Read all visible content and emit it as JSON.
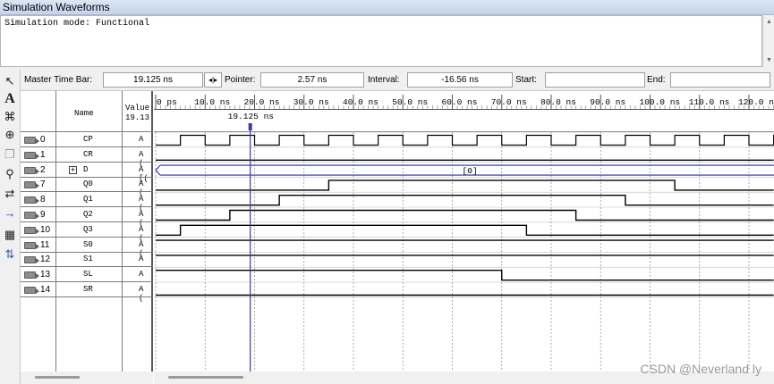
{
  "window": {
    "title": "Simulation Waveforms"
  },
  "sim_mode": {
    "text": "Simulation mode: Functional"
  },
  "info_bar": {
    "master_label": "Master Time Bar:",
    "master_value": "19.125 ns",
    "pointer_label": "Pointer:",
    "pointer_value": "2.57 ns",
    "interval_label": "Interval:",
    "interval_value": "-16.56 ns",
    "start_label": "Start:",
    "start_value": "",
    "end_label": "End:",
    "end_value": ""
  },
  "columns": {
    "name": "Name",
    "value_line1": "Value",
    "value_line2": "19.13"
  },
  "timescale": {
    "ticks": [
      "0 ps",
      "10.0 ns",
      "20.0 ns",
      "30.0 ns",
      "40.0 ns",
      "50.0 ns",
      "60.0 ns",
      "70.0 ns",
      "80.0 ns",
      "90.0 ns",
      "100.0 ns",
      "110.0 ns",
      "120.0 ns"
    ],
    "master_marker_label": "19.125 ns",
    "master_marker_time_ns": 19.125
  },
  "signals": [
    {
      "index": "0",
      "name": "CP",
      "value": "A",
      "kind": "clock",
      "expandable": false
    },
    {
      "index": "1",
      "name": "CR",
      "value": "A (",
      "kind": "bit",
      "expandable": false
    },
    {
      "index": "2",
      "name": "D",
      "value": "A [(",
      "kind": "bus",
      "expandable": true,
      "bus_label": "[0]"
    },
    {
      "index": "7",
      "name": "Q0",
      "value": "A (",
      "kind": "bit",
      "expandable": false
    },
    {
      "index": "8",
      "name": "Q1",
      "value": "A (",
      "kind": "bit",
      "expandable": false
    },
    {
      "index": "9",
      "name": "Q2",
      "value": "A (",
      "kind": "bit",
      "expandable": false
    },
    {
      "index": "10",
      "name": "Q3",
      "value": "A (",
      "kind": "bit",
      "expandable": false
    },
    {
      "index": "11",
      "name": "S0",
      "value": "A (",
      "kind": "bit",
      "expandable": false
    },
    {
      "index": "12",
      "name": "S1",
      "value": "A",
      "kind": "bit",
      "expandable": false
    },
    {
      "index": "13",
      "name": "SL",
      "value": "A",
      "kind": "bit",
      "expandable": false
    },
    {
      "index": "14",
      "name": "SR",
      "value": "A (",
      "kind": "bit",
      "expandable": false
    }
  ],
  "waveforms": {
    "CP": {
      "clock_period_ns": 10,
      "first_rise_ns": 5
    },
    "CR": {
      "segments": [
        [
          0,
          125,
          0
        ]
      ]
    },
    "Q0": {
      "segments": [
        [
          0,
          35,
          0
        ],
        [
          35,
          105,
          1
        ],
        [
          105,
          125,
          0
        ]
      ]
    },
    "Q1": {
      "segments": [
        [
          0,
          25,
          0
        ],
        [
          25,
          95,
          1
        ],
        [
          95,
          125,
          0
        ]
      ]
    },
    "Q2": {
      "segments": [
        [
          0,
          15,
          0
        ],
        [
          15,
          85,
          1
        ],
        [
          85,
          125,
          0
        ]
      ]
    },
    "Q3": {
      "segments": [
        [
          0,
          5,
          0
        ],
        [
          5,
          75,
          1
        ],
        [
          75,
          125,
          0
        ]
      ]
    },
    "S0": {
      "segments": [
        [
          0,
          125,
          1
        ]
      ]
    },
    "S1": {
      "segments": [
        [
          0,
          125,
          1
        ]
      ]
    },
    "SL": {
      "segments": [
        [
          0,
          70,
          1
        ],
        [
          70,
          125,
          0
        ]
      ]
    },
    "SR": {
      "segments": [
        [
          0,
          125,
          0
        ]
      ]
    }
  },
  "watermark": "CSDN @Neverland ly",
  "toolbar_icons": [
    "pointer-icon",
    "text-tool-icon",
    "waveform-editing-icon",
    "zoom-icon",
    "copy-icon",
    "find-icon",
    "replace-icon",
    "goto-icon",
    "group-icon",
    "sort-icon"
  ]
}
